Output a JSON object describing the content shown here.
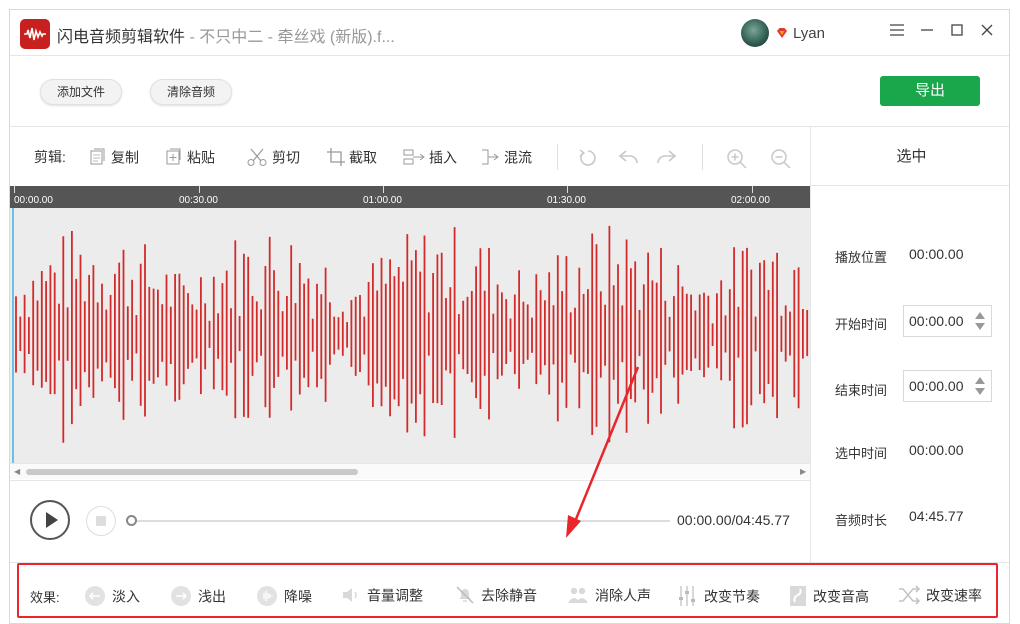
{
  "titlebar": {
    "app_name": "闪电音频剪辑软件",
    "file_title": " - 不只中二 - 牵丝戏 (新版).f...",
    "username": "Lyan",
    "menu_icon": "hamburger-icon",
    "minimize_icon": "minimize-icon",
    "maximize_icon": "maximize-icon",
    "close_icon": "close-icon"
  },
  "actions": {
    "add_file": "添加文件",
    "clear_audio": "清除音频",
    "export": "导出"
  },
  "toolbar": {
    "label": "剪辑:",
    "items": [
      {
        "label": "复制",
        "icon": "copy-icon"
      },
      {
        "label": "粘贴",
        "icon": "paste-icon"
      },
      {
        "label": "剪切",
        "icon": "scissors-icon"
      },
      {
        "label": "截取",
        "icon": "crop-icon"
      },
      {
        "label": "插入",
        "icon": "insert-icon"
      },
      {
        "label": "混流",
        "icon": "mix-icon"
      }
    ],
    "icon_buttons": [
      "reset-icon",
      "undo-icon",
      "redo-icon",
      "zoom-in-icon",
      "zoom-out-icon"
    ]
  },
  "timeline": {
    "ticks": [
      "00:00.00",
      "00:30.00",
      "01:00.00",
      "01:30.00",
      "02:00.00"
    ],
    "waveform_color": "#d22b2b"
  },
  "playback": {
    "time": "00:00.00/04:45.77",
    "progress": 0.0
  },
  "selection_panel": {
    "title": "选中",
    "play_position_label": "播放位置",
    "play_position": "00:00.00",
    "start_label": "开始时间",
    "start_value": "00:00.00",
    "end_label": "结束时间",
    "end_value": "00:00.00",
    "selected_label": "选中时间",
    "selected_value": "00:00.00",
    "duration_label": "音频时长",
    "duration_value": "04:45.77"
  },
  "effects": {
    "label": "效果:",
    "items": [
      {
        "label": "淡入",
        "icon": "fade-in-icon"
      },
      {
        "label": "浅出",
        "icon": "fade-out-icon"
      },
      {
        "label": "降噪",
        "icon": "denoise-icon"
      },
      {
        "label": "音量调整",
        "icon": "volume-icon"
      },
      {
        "label": "去除静音",
        "icon": "mute-remove-icon"
      },
      {
        "label": "消除人声",
        "icon": "vocal-remove-icon"
      },
      {
        "label": "改变节奏",
        "icon": "tempo-icon"
      },
      {
        "label": "改变音高",
        "icon": "pitch-icon"
      },
      {
        "label": "改变速率",
        "icon": "speed-icon"
      }
    ]
  },
  "colors": {
    "accent_green": "#1aa64a",
    "annotation_red": "#e8262b",
    "brand_red": "#c8201f"
  }
}
